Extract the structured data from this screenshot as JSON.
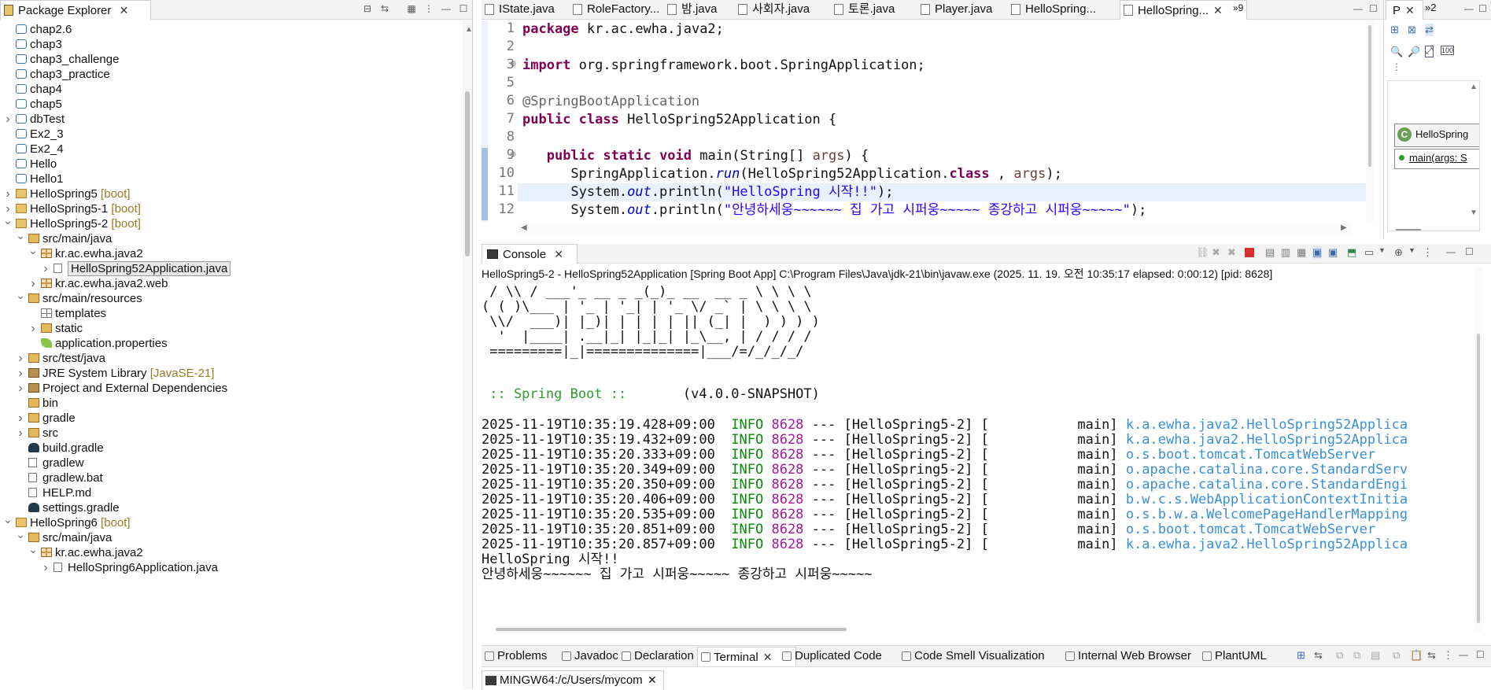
{
  "package_explorer": {
    "title": "Package Explorer",
    "tree": [
      {
        "label": "chap2.6",
        "level": 1,
        "icon": "folder-icon",
        "arrow": ""
      },
      {
        "label": "chap3",
        "level": 1,
        "icon": "folder-icon",
        "arrow": ""
      },
      {
        "label": "chap3_challenge",
        "level": 1,
        "icon": "folder-icon",
        "arrow": ""
      },
      {
        "label": "chap3_practice",
        "level": 1,
        "icon": "folder-icon",
        "arrow": ""
      },
      {
        "label": "chap4",
        "level": 1,
        "icon": "folder-icon",
        "arrow": ""
      },
      {
        "label": "chap5",
        "level": 1,
        "icon": "folder-icon",
        "arrow": ""
      },
      {
        "label": "dbTest",
        "level": 1,
        "icon": "folder-icon",
        "arrow": "›"
      },
      {
        "label": "Ex2_3",
        "level": 1,
        "icon": "folder-icon",
        "arrow": ""
      },
      {
        "label": "Ex2_4",
        "level": 1,
        "icon": "folder-icon",
        "arrow": ""
      },
      {
        "label": "Hello",
        "level": 1,
        "icon": "folder-icon",
        "arrow": ""
      },
      {
        "label": "Hello1",
        "level": 1,
        "icon": "folder-icon",
        "arrow": ""
      },
      {
        "label": "HelloSpring5",
        "suffix": "[boot]",
        "level": 1,
        "icon": "project-icon",
        "arrow": "›"
      },
      {
        "label": "HelloSpring5-1",
        "suffix": "[boot]",
        "level": 1,
        "icon": "project-icon",
        "arrow": "›"
      },
      {
        "label": "HelloSpring5-2",
        "suffix": "[boot]",
        "level": 1,
        "icon": "project-icon",
        "arrow": "⌄"
      },
      {
        "label": "src/main/java",
        "level": 2,
        "icon": "source-folder-icon",
        "arrow": "⌄"
      },
      {
        "label": "kr.ac.ewha.java2",
        "level": 3,
        "icon": "package-icon",
        "arrow": "⌄"
      },
      {
        "label": "HelloSpring52Application.java",
        "level": 4,
        "icon": "java-file-icon",
        "arrow": "›",
        "selected": true
      },
      {
        "label": "kr.ac.ewha.java2.web",
        "level": 3,
        "icon": "package-icon",
        "arrow": "›"
      },
      {
        "label": "src/main/resources",
        "level": 2,
        "icon": "source-folder-icon",
        "arrow": "⌄"
      },
      {
        "label": "templates",
        "level": 3,
        "icon": "grid-icon",
        "arrow": ""
      },
      {
        "label": "static",
        "level": 3,
        "icon": "source-folder-icon",
        "arrow": "›"
      },
      {
        "label": "application.properties",
        "level": 3,
        "icon": "leaf-icon",
        "arrow": ""
      },
      {
        "label": "src/test/java",
        "level": 2,
        "icon": "source-folder-icon",
        "arrow": "›"
      },
      {
        "label": "JRE System Library",
        "suffix": "[JavaSE-21]",
        "level": 2,
        "icon": "library-icon",
        "arrow": "›"
      },
      {
        "label": "Project and External Dependencies",
        "level": 2,
        "icon": "library-icon",
        "arrow": "›"
      },
      {
        "label": "bin",
        "level": 2,
        "icon": "source-folder-icon",
        "arrow": ""
      },
      {
        "label": "gradle",
        "level": 2,
        "icon": "source-folder-icon",
        "arrow": "›"
      },
      {
        "label": "src",
        "level": 2,
        "icon": "source-folder-icon",
        "arrow": "›"
      },
      {
        "label": "build.gradle",
        "level": 2,
        "icon": "gradle-icon",
        "arrow": ""
      },
      {
        "label": "gradlew",
        "level": 2,
        "icon": "file-icon",
        "arrow": ""
      },
      {
        "label": "gradlew.bat",
        "level": 2,
        "icon": "file-icon",
        "arrow": ""
      },
      {
        "label": "HELP.md",
        "level": 2,
        "icon": "file-icon",
        "arrow": ""
      },
      {
        "label": "settings.gradle",
        "level": 2,
        "icon": "gradle-icon",
        "arrow": ""
      },
      {
        "label": "HelloSpring6",
        "suffix": "[boot]",
        "level": 1,
        "icon": "project-icon",
        "arrow": "⌄"
      },
      {
        "label": "src/main/java",
        "level": 2,
        "icon": "source-folder-icon",
        "arrow": "⌄"
      },
      {
        "label": "kr.ac.ewha.java2",
        "level": 3,
        "icon": "package-icon",
        "arrow": "⌄"
      },
      {
        "label": "HelloSpring6Application.java",
        "level": 4,
        "icon": "java-file-icon",
        "arrow": "›"
      }
    ]
  },
  "editor": {
    "tabs": [
      "IState.java",
      "RoleFactory...",
      "밤.java",
      "사회자.java",
      "토론.java",
      "Player.java",
      "HelloSpring...",
      "HelloSpring..."
    ],
    "active_tab_index": 7,
    "overflow_count": "»9",
    "lines": [
      {
        "n": "1",
        "parts": [
          [
            "kw",
            "package"
          ],
          [
            "",
            "kr.ac.ewha.java2;"
          ]
        ]
      },
      {
        "n": "2",
        "parts": []
      },
      {
        "n": "3",
        "parts": [
          [
            "kw",
            "import"
          ],
          [
            "",
            "org.springframework.boot.SpringApplication;"
          ]
        ]
      },
      {
        "n": "5",
        "parts": []
      },
      {
        "n": "6",
        "parts": [
          [
            "ann",
            "@SpringBootApplication"
          ]
        ]
      },
      {
        "n": "7",
        "parts": [
          [
            "kw",
            "public"
          ],
          [
            "kw",
            "class"
          ],
          [
            "",
            "HelloSpring52Application {"
          ]
        ]
      },
      {
        "n": "8",
        "parts": []
      },
      {
        "n": "9",
        "parts": [
          [
            "",
            "   "
          ],
          [
            "kw",
            "public"
          ],
          [
            "kw",
            "static"
          ],
          [
            "kw",
            "void"
          ],
          [
            "",
            "main(String[] "
          ],
          [
            "arg",
            "args"
          ],
          [
            "",
            ") {"
          ]
        ]
      },
      {
        "n": "10",
        "parts": [
          [
            "",
            "      SpringApplication."
          ],
          [
            "fld",
            "run"
          ],
          [
            "",
            "(HelloSpring52Application."
          ],
          [
            "kw",
            "class"
          ],
          [
            "",
            ", "
          ],
          [
            "arg",
            "args"
          ],
          [
            "",
            ");"
          ]
        ]
      },
      {
        "n": "11",
        "parts": [
          [
            "",
            "      System."
          ],
          [
            "fld",
            "out"
          ],
          [
            "",
            ".println("
          ],
          [
            "str",
            "\"HelloSpring 시작!!\""
          ],
          [
            "",
            ");"
          ]
        ]
      },
      {
        "n": "12",
        "parts": [
          [
            "",
            "      System."
          ],
          [
            "fld",
            "out"
          ],
          [
            "",
            ".println("
          ],
          [
            "str",
            "\"안녕하세웅~~~~~~ 집 가고 시퍼웅~~~~~ 종강하고 시퍼웅~~~~~\""
          ],
          [
            "",
            ");"
          ]
        ]
      }
    ]
  },
  "outline": {
    "tab1": "P",
    "tab2": "»2",
    "class_name": "HelloSpring",
    "method": "main(args: S"
  },
  "console": {
    "title": "Console",
    "launch": "HelloSpring5-2 - HelloSpring52Application [Spring Boot App] C:\\Program Files\\Java\\jdk-21\\bin\\javaw.exe  (2025. 11. 19. 오전 10:35:17 elapsed: 0:00:12) [pid: 8628]",
    "banner": [
      " / \\\\ / ___'_ __ _ _(_)_ __  __ _ \\ \\ \\ \\",
      "( ( )\\___ | '_ | '_| | '_ \\/ _` | \\ \\ \\ \\",
      " \\\\/  ___)| |_)| | | | | || (_| |  ) ) ) )",
      "  '  |____| .__|_| |_|_| |_\\__, | / / / /",
      " =========|_|==============|___/=/_/_/_/"
    ],
    "spring_boot": " :: Spring Boot ::",
    "version": "(v4.0.0-SNAPSHOT)",
    "logs": [
      {
        "ts": "2025-11-19T10:35:19.428+09:00",
        "level": "INFO",
        "pid": "8628",
        "app": "[HelloSpring5-2]",
        "thread": "main]",
        "logger": "k.a.ewha.java2.HelloSpring52Applica"
      },
      {
        "ts": "2025-11-19T10:35:19.432+09:00",
        "level": "INFO",
        "pid": "8628",
        "app": "[HelloSpring5-2]",
        "thread": "main]",
        "logger": "k.a.ewha.java2.HelloSpring52Applica"
      },
      {
        "ts": "2025-11-19T10:35:20.333+09:00",
        "level": "INFO",
        "pid": "8628",
        "app": "[HelloSpring5-2]",
        "thread": "main]",
        "logger": "o.s.boot.tomcat.TomcatWebServer"
      },
      {
        "ts": "2025-11-19T10:35:20.349+09:00",
        "level": "INFO",
        "pid": "8628",
        "app": "[HelloSpring5-2]",
        "thread": "main]",
        "logger": "o.apache.catalina.core.StandardServ"
      },
      {
        "ts": "2025-11-19T10:35:20.350+09:00",
        "level": "INFO",
        "pid": "8628",
        "app": "[HelloSpring5-2]",
        "thread": "main]",
        "logger": "o.apache.catalina.core.StandardEngi"
      },
      {
        "ts": "2025-11-19T10:35:20.406+09:00",
        "level": "INFO",
        "pid": "8628",
        "app": "[HelloSpring5-2]",
        "thread": "main]",
        "logger": "b.w.c.s.WebApplicationContextInitia"
      },
      {
        "ts": "2025-11-19T10:35:20.535+09:00",
        "level": "INFO",
        "pid": "8628",
        "app": "[HelloSpring5-2]",
        "thread": "main]",
        "logger": "o.s.b.w.a.WelcomePageHandlerMapping"
      },
      {
        "ts": "2025-11-19T10:35:20.851+09:00",
        "level": "INFO",
        "pid": "8628",
        "app": "[HelloSpring5-2]",
        "thread": "main]",
        "logger": "o.s.boot.tomcat.TomcatWebServer"
      },
      {
        "ts": "2025-11-19T10:35:20.857+09:00",
        "level": "INFO",
        "pid": "8628",
        "app": "[HelloSpring5-2]",
        "thread": "main]",
        "logger": "k.a.ewha.java2.HelloSpring52Applica"
      }
    ],
    "output": [
      "HelloSpring 시작!!",
      "안녕하세웅~~~~~~ 집 가고 시퍼웅~~~~~ 종강하고 시퍼웅~~~~~"
    ]
  },
  "bottom_tabs": [
    "Problems",
    "Javadoc",
    "Declaration",
    "Terminal",
    "Duplicated Code",
    "Code Smell Visualization",
    "Internal Web Browser",
    "PlantUML"
  ],
  "bottom_active": 3,
  "terminal_tab": "MINGW64:/c/Users/mycom"
}
